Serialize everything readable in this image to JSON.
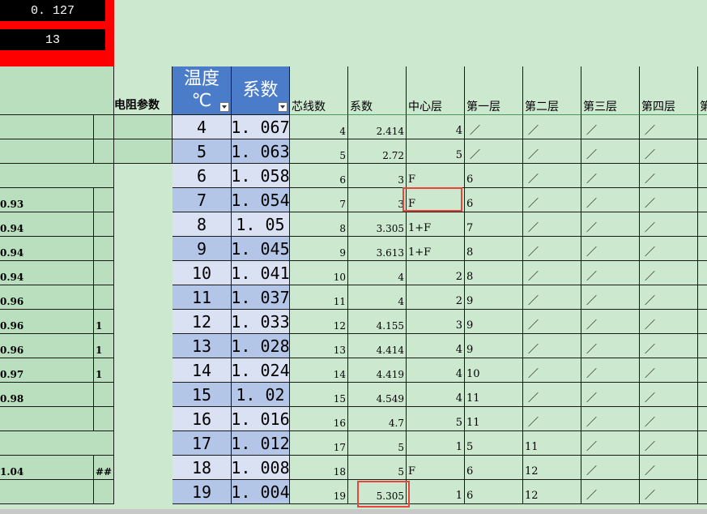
{
  "top_cells": [
    "0. 127",
    "13"
  ],
  "headers": {
    "param": "电阻参数",
    "temp_line1": "温度",
    "temp_line2": "℃",
    "coef_big": "系数",
    "cores": "芯线数",
    "coef": "系数",
    "center": "中心层",
    "layer1": "第一层",
    "layer2": "第二层",
    "layer3": "第三层",
    "layer4": "第四层",
    "layer5_partial": "第"
  },
  "rows": [
    {
      "a": "",
      "b": "",
      "temp": "4",
      "tc": "1. 067",
      "cores": "4",
      "coef": "2.414",
      "center": "4",
      "center_align": "right",
      "l1": "／",
      "l2": "／",
      "l3": "／",
      "l4": "／"
    },
    {
      "a": "",
      "b": "",
      "temp": "5",
      "tc": "1. 063",
      "cores": "5",
      "coef": "2.72",
      "center": "5",
      "center_align": "right",
      "l1": "／",
      "l2": "／",
      "l3": "／",
      "l4": "／"
    },
    {
      "a": "",
      "b": "",
      "temp": "6",
      "tc": "1. 058",
      "cores": "6",
      "coef": "3",
      "center": "F",
      "center_align": "left",
      "l1": "6",
      "l2": "／",
      "l3": "／",
      "l4": "／"
    },
    {
      "a": "0.93",
      "b": "",
      "temp": "7",
      "tc": "1. 054",
      "cores": "7",
      "coef": "3",
      "center": "F",
      "center_align": "left",
      "l1": "6",
      "l2": "／",
      "l3": "／",
      "l4": "／"
    },
    {
      "a": "0.94",
      "b": "",
      "temp": "8",
      "tc": "1. 05",
      "cores": "8",
      "coef": "3.305",
      "center": "1+F",
      "center_align": "left",
      "l1": "7",
      "l2": "／",
      "l3": "／",
      "l4": "／"
    },
    {
      "a": "0.94",
      "b": "",
      "temp": "9",
      "tc": "1. 045",
      "cores": "9",
      "coef": "3.613",
      "center": "1+F",
      "center_align": "left",
      "l1": "8",
      "l2": "／",
      "l3": "／",
      "l4": "／"
    },
    {
      "a": "0.94",
      "b": "",
      "temp": "10",
      "tc": "1. 041",
      "cores": "10",
      "coef": "4",
      "center": "2",
      "center_align": "right",
      "l1": "8",
      "l2": "／",
      "l3": "／",
      "l4": "／"
    },
    {
      "a": "0.96",
      "b": "",
      "temp": "11",
      "tc": "1. 037",
      "cores": "11",
      "coef": "4",
      "center": "2",
      "center_align": "right",
      "l1": "9",
      "l2": "／",
      "l3": "／",
      "l4": "／"
    },
    {
      "a": "0.96",
      "b": "1",
      "temp": "12",
      "tc": "1. 033",
      "cores": "12",
      "coef": "4.155",
      "center": "3",
      "center_align": "right",
      "l1": "9",
      "l2": "／",
      "l3": "／",
      "l4": "／"
    },
    {
      "a": "0.96",
      "b": "1",
      "temp": "13",
      "tc": "1. 028",
      "cores": "13",
      "coef": "4.414",
      "center": "4",
      "center_align": "right",
      "l1": "9",
      "l2": "／",
      "l3": "／",
      "l4": "／"
    },
    {
      "a": "0.97",
      "b": "1",
      "temp": "14",
      "tc": "1. 024",
      "cores": "14",
      "coef": "4.419",
      "center": "4",
      "center_align": "right",
      "l1": "10",
      "l2": "／",
      "l3": "／",
      "l4": "／"
    },
    {
      "a": "0.98",
      "b": "",
      "temp": "15",
      "tc": "1. 02",
      "cores": "15",
      "coef": "4.549",
      "center": "4",
      "center_align": "right",
      "l1": "11",
      "l2": "／",
      "l3": "／",
      "l4": "／"
    },
    {
      "a": "",
      "b": "",
      "temp": "16",
      "tc": "1. 016",
      "cores": "16",
      "coef": "4.7",
      "center": "5",
      "center_align": "right",
      "l1": "11",
      "l2": "／",
      "l3": "／",
      "l4": "／"
    },
    {
      "a": "",
      "b": "",
      "temp": "17",
      "tc": "1. 012",
      "cores": "17",
      "coef": "5",
      "center": "1",
      "center_align": "right",
      "l1": "5",
      "l2": "11",
      "l3": "／",
      "l4": "／"
    },
    {
      "a": "1.04",
      "b": "##",
      "temp": "18",
      "tc": "1. 008",
      "cores": "18",
      "coef": "5",
      "center": "F",
      "center_align": "left",
      "l1": "6",
      "l2": "12",
      "l3": "／",
      "l4": "／"
    },
    {
      "a": "",
      "b": "",
      "temp": "19",
      "tc": "1. 004",
      "cores": "19",
      "coef": "5.305",
      "center": "1",
      "center_align": "right",
      "l1": "6",
      "l2": "12",
      "l3": "／",
      "l4": "／"
    }
  ],
  "colors": {
    "sheet_bg": "#cce8cf",
    "header_blue": "#4b7cc9",
    "temp_light": "#d9e1f2",
    "temp_dark": "#b4c6e7",
    "highlight_red": "#e8453c",
    "top_red": "#ff0000"
  }
}
